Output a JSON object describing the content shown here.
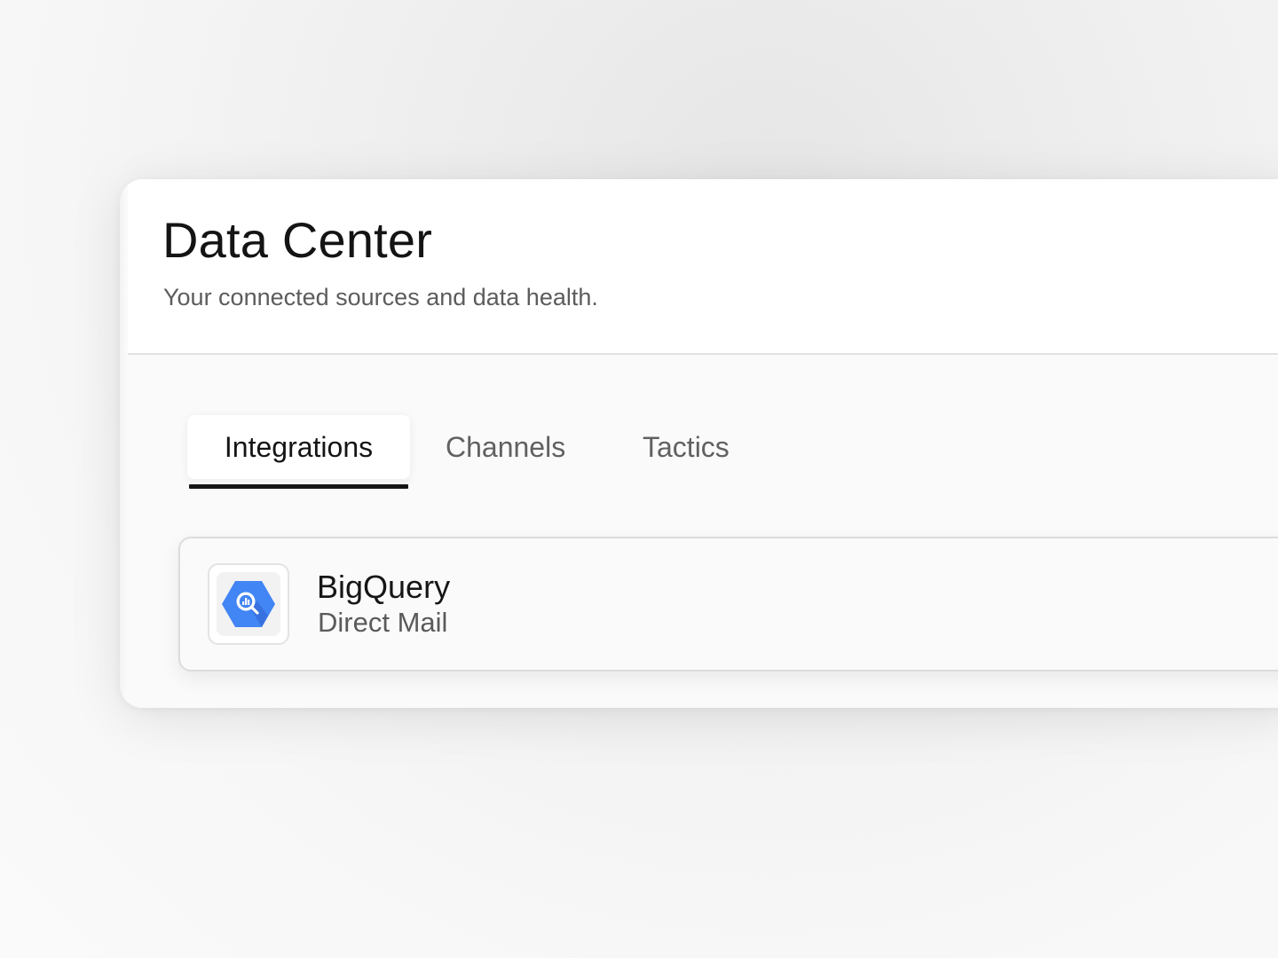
{
  "header": {
    "title": "Data Center",
    "subtitle": "Your connected sources and data health."
  },
  "tabs": [
    {
      "label": "Integrations",
      "active": true
    },
    {
      "label": "Channels",
      "active": false
    },
    {
      "label": "Tactics",
      "active": false
    }
  ],
  "integrations": [
    {
      "name": "BigQuery",
      "channel": "Direct Mail",
      "icon": "bigquery-icon",
      "icon_color": "#4285F4"
    }
  ],
  "colors": {
    "accent": "#151515",
    "bigquery_blue": "#4285F4"
  }
}
